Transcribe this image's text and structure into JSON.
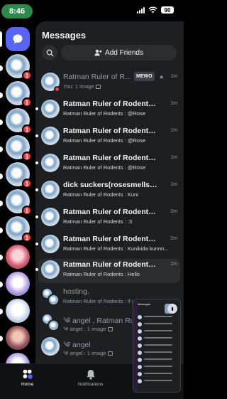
{
  "status_bar": {
    "time": "8:46",
    "battery": "90"
  },
  "header": {
    "title": "Messages",
    "add_friends_label": "Add Friends"
  },
  "dm_list": [
    {
      "name": "Ratman Ruler of R...",
      "preview": "You: 1 image",
      "time": "1m",
      "tag": "MEWO",
      "muted": true
    },
    {
      "name": "Ratman Ruler of Rodents",
      "preview": "Ratman Ruler of Rodents : @Rose",
      "time": "1m"
    },
    {
      "name": "Ratman Ruler of Rodents",
      "preview": "Ratman Ruler of Rodents : @Rose",
      "time": "1m"
    },
    {
      "name": "Ratman Ruler of Rodents",
      "preview": "Ratman Ruler of Rodents : @Rose",
      "time": "1m"
    },
    {
      "name": "dick suckers(rosesmellslikera...",
      "preview": "Ratman Ruler of Rodents : Kuni",
      "time": "1m"
    },
    {
      "name": "Ratman Ruler of Rodents",
      "preview": "Ratman Ruler of Rodents : :3",
      "time": "2m"
    },
    {
      "name": "Ratman Ruler of Rodents",
      "preview": "Ratman Ruler of Rodents : Kunikida kunnn...",
      "time": "2m"
    },
    {
      "name": "Ratman Ruler of Rodents",
      "preview": "Ratman Ruler of Rodents : Hello",
      "time": "2m",
      "active": true
    },
    {
      "name": "hosting.",
      "preview": "Ratman Ruler of Rodents : if you're staticin...",
      "time": "",
      "muted": true
    },
    {
      "name": "༄ angel , Ratman Ru...",
      "preview": "༄ angel : 1 image",
      "time": "",
      "muted": true
    },
    {
      "name": "༄ angel",
      "preview": "༄ angel : 1 image",
      "time": "",
      "muted": true
    }
  ],
  "rail": {
    "badge": "1"
  },
  "tabs": {
    "home": "Home",
    "notifications": "Notifications"
  },
  "pip": {
    "title": "Messages"
  },
  "colors": {
    "accent": "#5865f2",
    "badge": "#f23f43",
    "time_pill": "#2e8a4b"
  }
}
